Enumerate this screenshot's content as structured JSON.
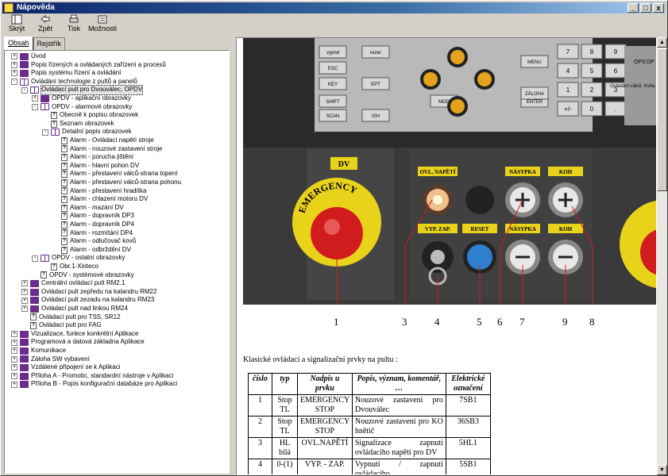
{
  "window": {
    "title": "Nápověda"
  },
  "titlebar_buttons": [
    "_",
    "□",
    "x"
  ],
  "toolbar": [
    {
      "label": "Skrýt",
      "icon": "hide-icon"
    },
    {
      "label": "Zpět",
      "icon": "back-icon"
    },
    {
      "label": "Tisk",
      "icon": "print-icon"
    },
    {
      "label": "Možnosti",
      "icon": "options-icon"
    }
  ],
  "tabs": [
    "Obsah",
    "Rejstřík"
  ],
  "tree": [
    {
      "level": 0,
      "exp": "+",
      "icon": "book",
      "label": "Úvod"
    },
    {
      "level": 0,
      "exp": "+",
      "icon": "book",
      "label": "Popis řízených a ovládaných zařízení a procesů"
    },
    {
      "level": 0,
      "exp": "+",
      "icon": "book",
      "label": "Popis systému řízení a ovládání"
    },
    {
      "level": 0,
      "exp": "-",
      "icon": "book-open",
      "label": "Ovládání technologie z pultů a panelů"
    },
    {
      "level": 1,
      "exp": "-",
      "icon": "book-open",
      "label": "Ovládací pult pro Dvouválec, OPDV",
      "selected": true
    },
    {
      "level": 2,
      "exp": "+",
      "icon": "book",
      "label": "OPDV - aplikační obrazovky"
    },
    {
      "level": 2,
      "exp": "-",
      "icon": "book-open",
      "label": "OPDV - alarmové obrazovky"
    },
    {
      "level": 3,
      "exp": "",
      "icon": "page",
      "label": "Obecně k popisu obrazovek"
    },
    {
      "level": 3,
      "exp": "",
      "icon": "page",
      "label": "Seznam obrazovek"
    },
    {
      "level": 3,
      "exp": "-",
      "icon": "book-open",
      "label": "Detailní popis obrazovek"
    },
    {
      "level": 4,
      "exp": "",
      "icon": "page",
      "label": "Alarm - Ovládací napětí stroje"
    },
    {
      "level": 4,
      "exp": "",
      "icon": "page",
      "label": "Alarm - nouzové zastavení stroje"
    },
    {
      "level": 4,
      "exp": "",
      "icon": "page",
      "label": "Alarm - porucha jištění"
    },
    {
      "level": 4,
      "exp": "",
      "icon": "page",
      "label": "Alarm - hlavní pohon DV"
    },
    {
      "level": 4,
      "exp": "",
      "icon": "page",
      "label": "Alarm - přestavení válců-strana topení"
    },
    {
      "level": 4,
      "exp": "",
      "icon": "page",
      "label": "Alarm - přestavení válců-strana pohonu"
    },
    {
      "level": 4,
      "exp": "",
      "icon": "page",
      "label": "Alarm - přestavení hradítka"
    },
    {
      "level": 4,
      "exp": "",
      "icon": "page",
      "label": "Alarm - chlazení motoru DV"
    },
    {
      "level": 4,
      "exp": "",
      "icon": "page",
      "label": "Alarm - mazání DV"
    },
    {
      "level": 4,
      "exp": "",
      "icon": "page",
      "label": "Alarm - dopravník DP3"
    },
    {
      "level": 4,
      "exp": "",
      "icon": "page",
      "label": "Alarm - dopravník DP4"
    },
    {
      "level": 4,
      "exp": "",
      "icon": "page",
      "label": "Alarm - rozmítání DP4"
    },
    {
      "level": 4,
      "exp": "",
      "icon": "page",
      "label": "Alarm - odlučovač kovů"
    },
    {
      "level": 4,
      "exp": "",
      "icon": "page",
      "label": "Alarm - odbrždění DV"
    },
    {
      "level": 2,
      "exp": "-",
      "icon": "book-open",
      "label": "OPDV - ostatní obrazovky"
    },
    {
      "level": 3,
      "exp": "",
      "icon": "page",
      "label": "Obr.1-Xinteco"
    },
    {
      "level": 2,
      "exp": "",
      "icon": "page",
      "label": "OPDV - systémové obrazovky"
    },
    {
      "level": 1,
      "exp": "+",
      "icon": "book",
      "label": "Centrální ovládací pult RM2.1"
    },
    {
      "level": 1,
      "exp": "+",
      "icon": "book",
      "label": "Ovládací pult zepředu na kalandru RM22"
    },
    {
      "level": 1,
      "exp": "+",
      "icon": "book",
      "label": "Ovládací pult zezadu na kalandru RM23"
    },
    {
      "level": 1,
      "exp": "+",
      "icon": "book",
      "label": "Ovládací pult nad linkou RM24"
    },
    {
      "level": 1,
      "exp": "",
      "icon": "page",
      "label": "Ovládací pult pro TSS, SR12"
    },
    {
      "level": 1,
      "exp": "",
      "icon": "page",
      "label": "Ovládací pult pro FAG"
    },
    {
      "level": 0,
      "exp": "+",
      "icon": "book",
      "label": "Vizualizace, funkce konkrétní Aplikace"
    },
    {
      "level": 0,
      "exp": "+",
      "icon": "book",
      "label": "Programová a datová základna Aplikace"
    },
    {
      "level": 0,
      "exp": "+",
      "icon": "book",
      "label": "Komunikace"
    },
    {
      "level": 0,
      "exp": "+",
      "icon": "book",
      "label": "Záloha SW vybavení"
    },
    {
      "level": 0,
      "exp": "+",
      "icon": "book",
      "label": "Vzdálené připojení se k Aplikaci"
    },
    {
      "level": 0,
      "exp": "+",
      "icon": "book",
      "label": "Příloha A - Promotic, standardní nástroje v Aplikaci"
    },
    {
      "level": 0,
      "exp": "+",
      "icon": "book",
      "label": "Příloha B - Popis konfigurační databáze pro Aplikaci"
    }
  ],
  "photo": {
    "keypad_left": [
      "vypnd",
      "rezer",
      "ESC",
      "MENU",
      "MOD",
      "SHIFT",
      "ENTER",
      "ZÁLOHA",
      "KEY",
      "EPT",
      "SCAN",
      "ISH"
    ],
    "keypad_right": [
      "7",
      "8",
      "9",
      "4",
      "5",
      "6",
      "1",
      "2",
      "3",
      "+/-",
      "0",
      "."
    ],
    "right_labels": [
      "OPS",
      "DP",
      "Ovládání válců",
      "Kvita"
    ],
    "dv_label": "DV",
    "emergency_text": "EMERGENCY",
    "plates": [
      "OVL. NAPĚTÍ",
      "NÁSYPKA",
      "KOH",
      "VYP.    ZAP.",
      "RESET",
      "NÁSYPKA",
      "KOH"
    ]
  },
  "callouts": [
    "1",
    "3",
    "4",
    "5",
    "6",
    "7",
    "9",
    "8"
  ],
  "intro_text": "Klasické ovládací a signalizační prvky na pultu :",
  "table": {
    "headers": [
      "číslo",
      "typ",
      "Nadpis u prvku",
      "Popis, význam, komentář, …",
      "Elektrické označení"
    ],
    "rows": [
      [
        "1",
        "Stop TL",
        "EMERGENCY STOP",
        "Nouzové zastavení pro Dvouválec",
        "7SB1"
      ],
      [
        "2",
        "Stop TL",
        "EMERGENCY STOP",
        "Nouzové zastavení pro KO hnětič",
        "36SB3"
      ],
      [
        "3",
        "HL bílá",
        "OVL.NAPĚTÍ",
        "Signalizace zapnutí ovládacího napětí pro DV",
        "5HL1"
      ],
      [
        "4",
        "0-(1)",
        "VYP. - ZAP.",
        "Vypnutí / zapnutí ovládacího",
        "5SB1"
      ]
    ]
  },
  "colors": {
    "title_start": "#0a246a",
    "title_end": "#a6caf0",
    "book": "#6b2c8a",
    "emergency_red": "#d01c1c",
    "plate_yellow": "#e9d21a",
    "reset_blue": "#2f7fd0"
  }
}
